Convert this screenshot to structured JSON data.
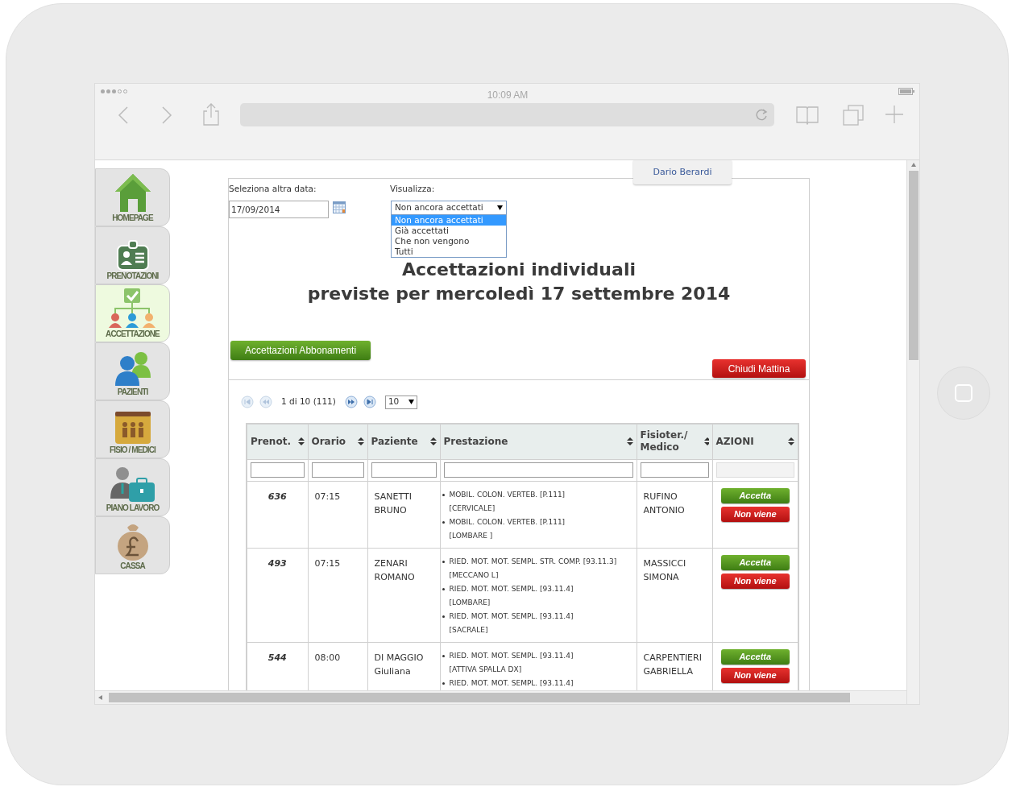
{
  "device": {
    "status_time": "10:09 AM"
  },
  "sidebar": {
    "items": [
      {
        "label": "HOMEPAGE",
        "kind": "home",
        "selected": false
      },
      {
        "label": "PRENOTAZIONI",
        "kind": "badge",
        "selected": false
      },
      {
        "label": "ACCETTAZIONE",
        "kind": "org",
        "selected": true
      },
      {
        "label": "PAZIENTI",
        "kind": "people",
        "selected": false
      },
      {
        "label": "FISIO / MEDICI",
        "kind": "folder",
        "selected": false
      },
      {
        "label": "PIANO LAVORO",
        "kind": "worker",
        "selected": false
      },
      {
        "label": "CASSA",
        "kind": "money",
        "selected": false
      }
    ]
  },
  "user_tab": "Dario Berardi",
  "date_picker": {
    "label": "Seleziona altra data:",
    "value": "17/09/2014"
  },
  "view_select": {
    "label": "Visualizza:",
    "value": "Non ancora accettati",
    "expanded": true,
    "options": [
      {
        "label": "Non ancora accettati",
        "selected": true
      },
      {
        "label": "Già accettati",
        "selected": false
      },
      {
        "label": "Che non vengono",
        "selected": false
      },
      {
        "label": "Tutti",
        "selected": false
      }
    ]
  },
  "title_lines": [
    "Accettazioni individuali",
    "previste per mercoledì 17 settembre 2014"
  ],
  "buttons": {
    "abbonamenti": "Accettazioni Abbonamenti",
    "chiudi": "Chiudi Mattina"
  },
  "pager": {
    "text": "1 di 10 (111)",
    "page_size": "10"
  },
  "table": {
    "columns": [
      {
        "label": "Prenot.",
        "filter_disabled": false
      },
      {
        "label": "Orario",
        "filter_disabled": false
      },
      {
        "label": "Paziente",
        "filter_disabled": false
      },
      {
        "label": "Prestazione",
        "filter_disabled": false
      },
      {
        "label": "Fisioter./ Medico",
        "filter_disabled": false
      },
      {
        "label": "AZIONI",
        "filter_disabled": true
      }
    ],
    "rows": [
      {
        "prenot": "636",
        "orario": "07:15",
        "paziente": [
          "SANETTI",
          "BRUNO"
        ],
        "prestazioni": [
          {
            "code": "MOBIL. COLON. VERTEB. [P.111]",
            "site": "[CERVICALE]"
          },
          {
            "code": "MOBIL. COLON. VERTEB. [P.111]",
            "site": "[LOMBARE ]"
          }
        ],
        "medico": [
          "RUFINO",
          "ANTONIO"
        ],
        "actions": [
          "Accetta",
          "Non viene"
        ]
      },
      {
        "prenot": "493",
        "orario": "07:15",
        "paziente": [
          "ZENARI",
          "ROMANO"
        ],
        "prestazioni": [
          {
            "code": "RIED. MOT. MOT. SEMPL. STR. COMP. [93.11.3]",
            "site": "[MECCANO L]"
          },
          {
            "code": "RIED. MOT. MOT. SEMPL. [93.11.4]",
            "site": "[LOMBARE]"
          },
          {
            "code": "RIED. MOT. MOT. SEMPL. [93.11.4]",
            "site": "[SACRALE]"
          }
        ],
        "medico": [
          "MASSICCI",
          "SIMONA"
        ],
        "actions": [
          "Accetta",
          "Non viene"
        ]
      },
      {
        "prenot": "544",
        "orario": "08:00",
        "paziente": [
          "DI MAGGIO",
          "Giuliana"
        ],
        "prestazioni": [
          {
            "code": "RIED. MOT. MOT. SEMPL. [93.11.4]",
            "site": "[ATTIVA SPALLA DX]"
          },
          {
            "code": "RIED. MOT. MOT. SEMPL. [93.11.4]"
          }
        ],
        "medico": [
          "CARPENTIERI",
          "GABRIELLA"
        ],
        "actions": [
          "Accetta",
          "Non viene"
        ]
      }
    ]
  }
}
